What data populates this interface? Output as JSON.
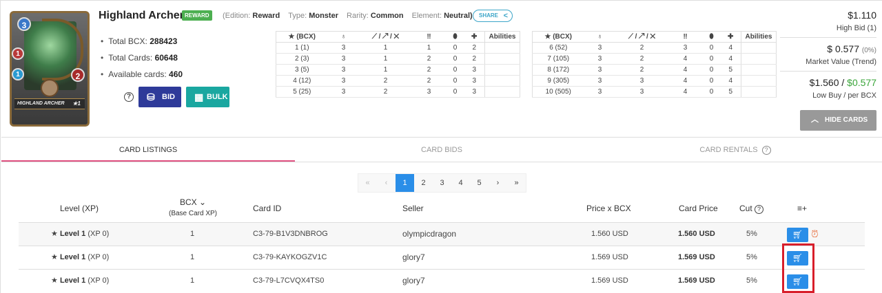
{
  "card": {
    "name": "Highland Archer",
    "badge": "REWARD",
    "edition_label": "(Edition:",
    "edition_value": "Reward",
    "type_label": "Type:",
    "type_value": "Monster",
    "rarity_label": "Rarity:",
    "rarity_value": "Common",
    "element_label": "Element:",
    "element_value": "Neutral)",
    "share_label": "SHARE",
    "image": {
      "name_strip": "HIGHLAND ARCHER",
      "level": "★1",
      "mana": "3",
      "melee": "1",
      "speed": "1",
      "health": "2"
    }
  },
  "stats": {
    "total_bcx_label": "Total BCX:",
    "total_bcx": "288423",
    "total_cards_label": "Total Cards:",
    "total_cards": "60648",
    "available_label": "Available cards:",
    "available": "460"
  },
  "actions": {
    "help": "?",
    "bid": "BID",
    "bulk": "BULK"
  },
  "level_table": {
    "headers": [
      "★ (BCX)",
      "♁",
      "⟋ / ↗ / ✕",
      "‼",
      "⬮",
      "✚",
      "Abilities"
    ],
    "left_rows": [
      [
        "1 (1)",
        "3",
        "1",
        "1",
        "0",
        "2",
        ""
      ],
      [
        "2 (3)",
        "3",
        "1",
        "2",
        "0",
        "2",
        ""
      ],
      [
        "3 (5)",
        "3",
        "1",
        "2",
        "0",
        "3",
        ""
      ],
      [
        "4 (12)",
        "3",
        "2",
        "2",
        "0",
        "3",
        ""
      ],
      [
        "5 (25)",
        "3",
        "2",
        "3",
        "0",
        "3",
        ""
      ]
    ],
    "right_rows": [
      [
        "6 (52)",
        "3",
        "2",
        "3",
        "0",
        "4",
        ""
      ],
      [
        "7 (105)",
        "3",
        "2",
        "4",
        "0",
        "4",
        ""
      ],
      [
        "8 (172)",
        "3",
        "2",
        "4",
        "0",
        "5",
        ""
      ],
      [
        "9 (305)",
        "3",
        "3",
        "4",
        "0",
        "4",
        ""
      ],
      [
        "10 (505)",
        "3",
        "3",
        "4",
        "0",
        "5",
        ""
      ]
    ]
  },
  "prices": {
    "high_bid": "$1.110",
    "high_bid_label": "High Bid (1)",
    "market_value": "$ 0.577",
    "market_trend": "(0%)",
    "market_label": "Market Value (Trend)",
    "low_buy": "$1.560",
    "slash": "/",
    "per_bcx": "$0.577",
    "low_label": "Low Buy / per BCX",
    "hide_cards": "HIDE CARDS"
  },
  "tabs": {
    "listings": "CARD LISTINGS",
    "bids": "CARD BIDS",
    "rentals": "CARD RENTALS"
  },
  "pager": [
    "«",
    "‹",
    "1",
    "2",
    "3",
    "4",
    "5",
    "›",
    "»"
  ],
  "listing_headers": {
    "level": "Level (XP)",
    "bcx": "BCX",
    "bcx_sub": "(Base Card XP)",
    "card_id": "Card ID",
    "seller": "Seller",
    "price_bcx": "Price x BCX",
    "card_price": "Card Price",
    "cut": "Cut",
    "add": "≡+"
  },
  "listings": [
    {
      "level": "Level 1",
      "xp": "(XP 0)",
      "bcx": "1",
      "card_id": "C3-79-B1V3DNBROG",
      "seller": "olympicdragon",
      "price_bcx": "1.560 USD",
      "card_price": "1.560 USD",
      "cut": "5%"
    },
    {
      "level": "Level 1",
      "xp": "(XP 0)",
      "bcx": "1",
      "card_id": "C3-79-KAYKOGZV1C",
      "seller": "glory7",
      "price_bcx": "1.569 USD",
      "card_price": "1.569 USD",
      "cut": "5%"
    },
    {
      "level": "Level 1",
      "xp": "(XP 0)",
      "bcx": "1",
      "card_id": "C3-79-L7CVQX4TS0",
      "seller": "glory7",
      "price_bcx": "1.569 USD",
      "card_price": "1.569 USD",
      "cut": "5%"
    }
  ]
}
